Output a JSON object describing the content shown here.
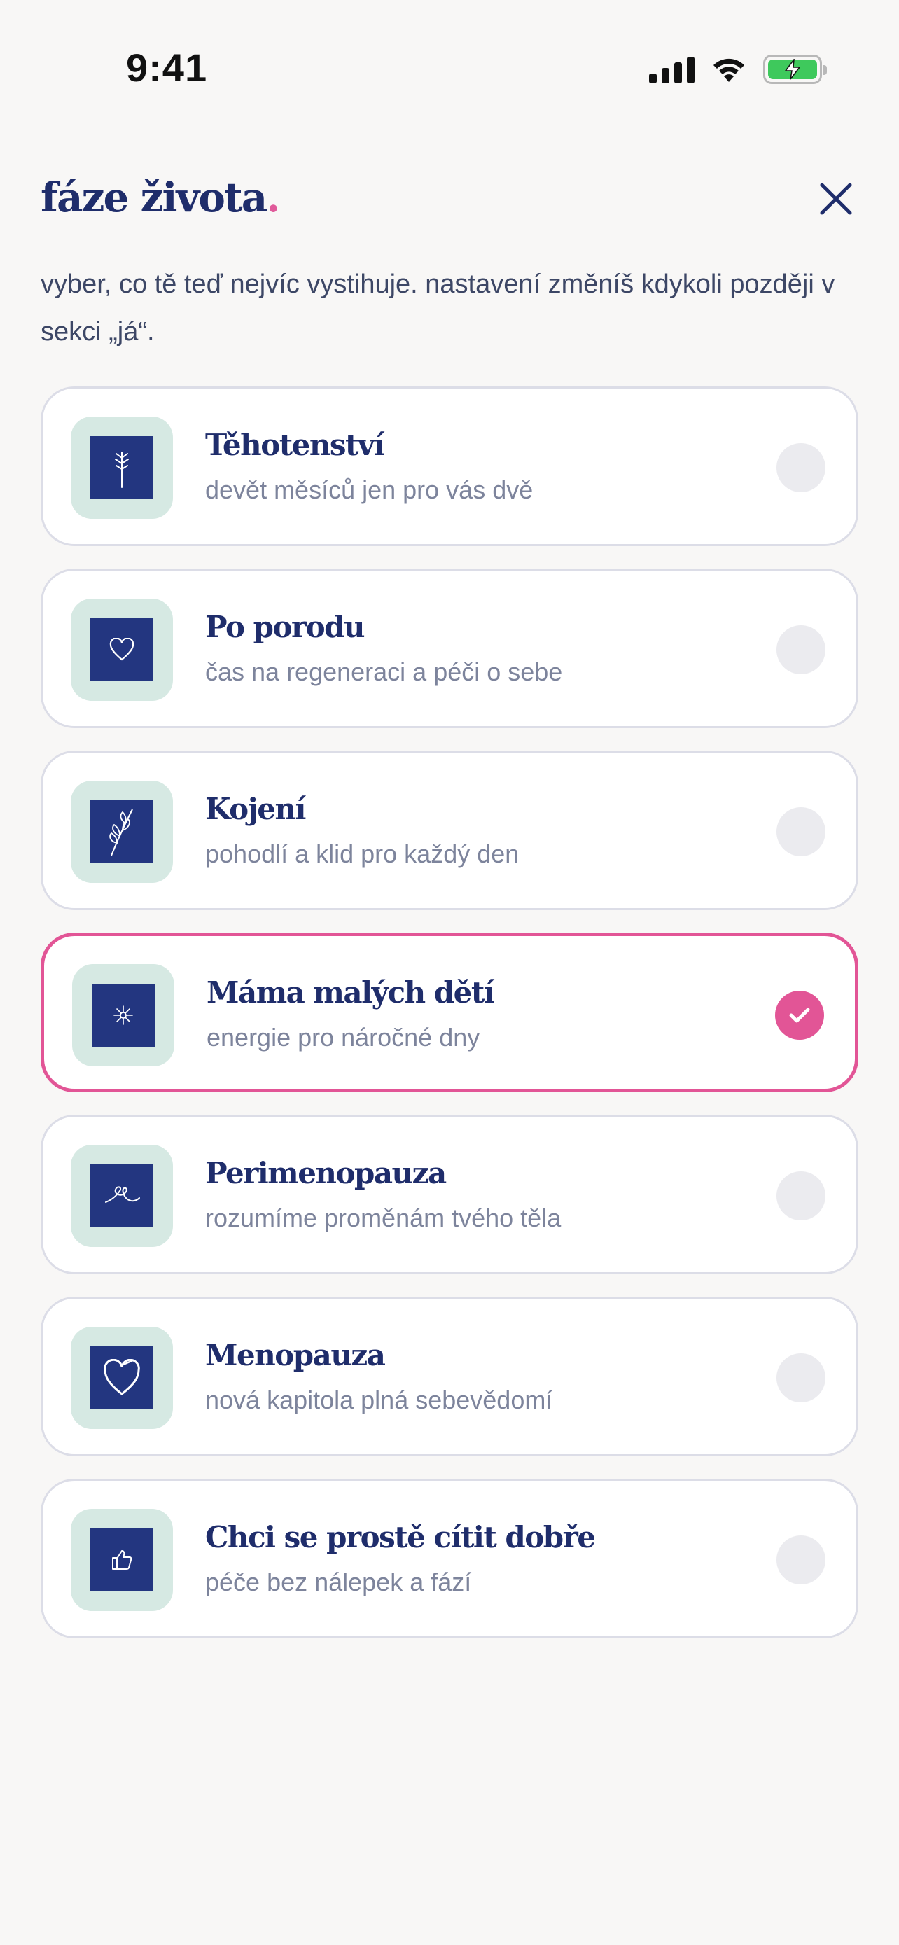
{
  "status_bar": {
    "time": "9:41",
    "icons": [
      "signal-icon",
      "wifi-icon",
      "battery-charging-icon"
    ],
    "battery_color": "#3ec95c"
  },
  "header": {
    "title": "fáze života",
    "title_dot": ".",
    "close_icon": "close-icon"
  },
  "intro": "vyber, co tě teď nejvíc vystihuje. nastavení změníš kdykoli později v sekci „já“.",
  "colors": {
    "accent": "#e25596",
    "primary": "#1f2d6b",
    "tile_bg": "#d6e9e3",
    "icon_bg": "#233680"
  },
  "options": [
    {
      "title": "Těhotenství",
      "subtitle": "devět měsíců jen pro vás dvě",
      "icon": "wheat-icon",
      "selected": false
    },
    {
      "title": "Po porodu",
      "subtitle": "čas na regeneraci a péči o sebe",
      "icon": "heart-icon",
      "selected": false
    },
    {
      "title": "Kojení",
      "subtitle": "pohodlí a klid pro každý den",
      "icon": "leaf-icon",
      "selected": false
    },
    {
      "title": "Máma malých dětí",
      "subtitle": "energie pro náročné dny",
      "icon": "sparkle-icon",
      "selected": true
    },
    {
      "title": "Perimenopauza",
      "subtitle": "rozumíme proměnám tvého těla",
      "icon": "swirl-icon",
      "selected": false
    },
    {
      "title": "Menopauza",
      "subtitle": "nová kapitola plná sebevědomí",
      "icon": "heart-outline-icon",
      "selected": false
    },
    {
      "title": "Chci se prostě cítit dobře",
      "subtitle": "péče bez nálepek a fází",
      "icon": "thumbs-up-icon",
      "selected": false
    }
  ]
}
